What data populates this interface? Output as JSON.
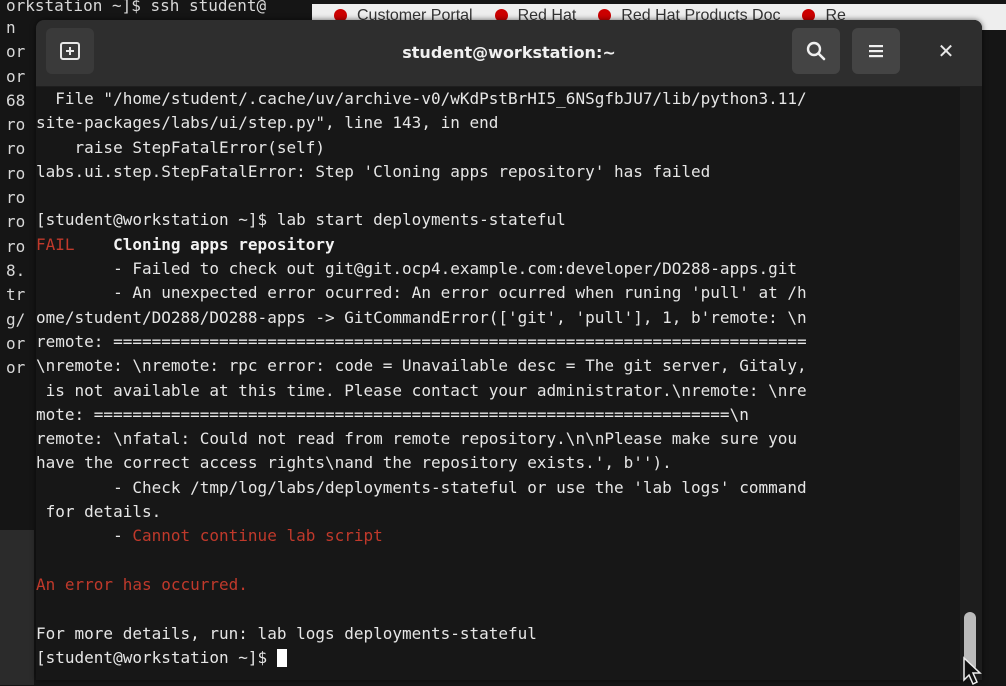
{
  "background_terminal": {
    "top_line": "orkstation ~]$ ssh student@",
    "column_fragments": [
      "n",
      "or",
      "",
      "",
      "or",
      "68",
      "ro",
      "ro",
      "ro",
      "ro",
      "ro",
      "ro",
      "",
      "8.",
      "tr",
      "g/",
      "or",
      "",
      "or"
    ]
  },
  "browser_tabs": [
    {
      "label": "Customer Portal"
    },
    {
      "label": "Red Hat"
    },
    {
      "label": "Red Hat Products Doc"
    },
    {
      "label": "Re"
    }
  ],
  "window": {
    "title": "student@workstation:~",
    "buttons": {
      "new_tab": "new-tab-icon",
      "search": "search-icon",
      "menu": "hamburger-menu-icon",
      "close": "✕"
    }
  },
  "terminal_lines": [
    {
      "segments": [
        {
          "text": "  File \"/home/student/.cache/uv/archive-v0/wKdPstBrHI5_6NSgfbJU7/lib/python3.11/"
        }
      ]
    },
    {
      "segments": [
        {
          "text": "site-packages/labs/ui/step.py\", line 143, in end"
        }
      ]
    },
    {
      "segments": [
        {
          "text": "    raise StepFatalError(self)"
        }
      ]
    },
    {
      "segments": [
        {
          "text": "labs.ui.step.StepFatalError: Step 'Cloning apps repository' has failed"
        }
      ]
    },
    {
      "segments": [
        {
          "text": ""
        }
      ]
    },
    {
      "segments": [
        {
          "text": "[student@workstation ~]$ lab start deployments-stateful"
        }
      ]
    },
    {
      "segments": [
        {
          "text": "FAIL",
          "style": "fail"
        },
        {
          "text": "    "
        },
        {
          "text": "Cloning apps repository",
          "style": "bold"
        }
      ]
    },
    {
      "segments": [
        {
          "text": "        - Failed to check out git@git.ocp4.example.com:developer/DO288-apps.git"
        }
      ]
    },
    {
      "segments": [
        {
          "text": "        - An unexpected error ocurred: An error ocurred when runing 'pull' at /h"
        }
      ]
    },
    {
      "segments": [
        {
          "text": "ome/student/DO288/DO288-apps -> GitCommandError(['git', 'pull'], 1, b'remote: \\n"
        }
      ]
    },
    {
      "segments": [
        {
          "text": "remote: ========================================================================"
        }
      ]
    },
    {
      "segments": [
        {
          "text": "\\nremote: \\nremote: rpc error: code = Unavailable desc = The git server, Gitaly,"
        }
      ]
    },
    {
      "segments": [
        {
          "text": " is not available at this time. Please contact your administrator.\\nremote: \\nre"
        }
      ]
    },
    {
      "segments": [
        {
          "text": "mote: ==================================================================\\n"
        }
      ]
    },
    {
      "segments": [
        {
          "text": "remote: \\nfatal: Could not read from remote repository.\\n\\nPlease make sure you"
        }
      ]
    },
    {
      "segments": [
        {
          "text": "have the correct access rights\\nand the repository exists.', b'')."
        }
      ]
    },
    {
      "segments": [
        {
          "text": "        - Check /tmp/log/labs/deployments-stateful or use the 'lab logs' command"
        }
      ]
    },
    {
      "segments": [
        {
          "text": " for details."
        }
      ]
    },
    {
      "segments": [
        {
          "text": "        - "
        },
        {
          "text": "Cannot continue lab script",
          "style": "err"
        }
      ]
    },
    {
      "segments": [
        {
          "text": ""
        }
      ]
    },
    {
      "segments": [
        {
          "text": "An error has occurred.",
          "style": "err"
        }
      ]
    },
    {
      "segments": [
        {
          "text": ""
        }
      ]
    },
    {
      "segments": [
        {
          "text": "For more details, run: lab logs deployments-stateful"
        }
      ]
    },
    {
      "segments": [
        {
          "text": "[student@workstation ~]$ "
        }
      ],
      "cursor": true
    }
  ],
  "colors": {
    "titlebar": "#2e2e2e",
    "terminal_bg": "#171717",
    "error_red": "#c0392b",
    "text": "#e6e6e6"
  }
}
